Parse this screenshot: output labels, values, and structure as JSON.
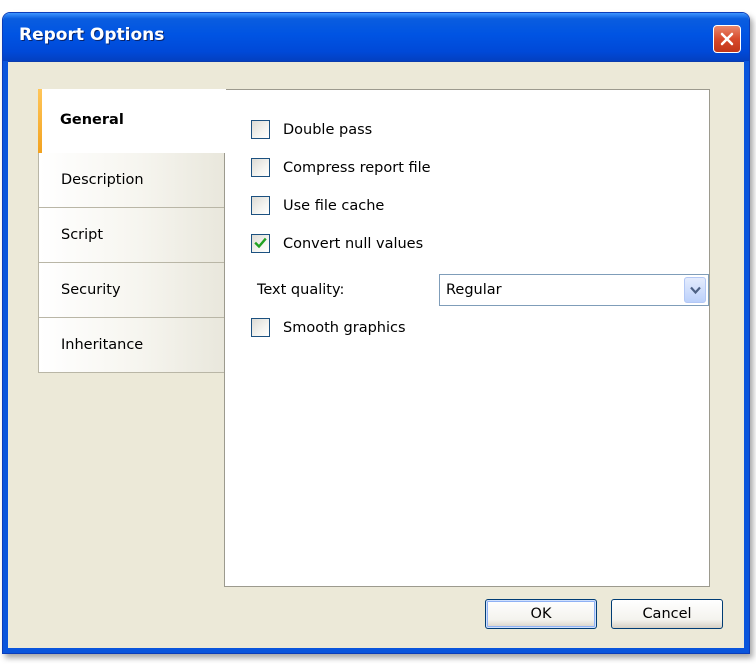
{
  "window": {
    "title": "Report Options"
  },
  "tabs": [
    {
      "label": "General",
      "active": true
    },
    {
      "label": "Description",
      "active": false
    },
    {
      "label": "Script",
      "active": false
    },
    {
      "label": "Security",
      "active": false
    },
    {
      "label": "Inheritance",
      "active": false
    }
  ],
  "general": {
    "double_pass": {
      "label": "Double pass",
      "checked": false
    },
    "compress": {
      "label": "Compress report file",
      "checked": false
    },
    "file_cache": {
      "label": "Use file cache",
      "checked": false
    },
    "convert_null": {
      "label": "Convert null values",
      "checked": true
    },
    "text_quality": {
      "label": "Text quality:",
      "value": "Regular"
    },
    "smooth_graphics": {
      "label": "Smooth graphics",
      "checked": false
    }
  },
  "buttons": {
    "ok": "OK",
    "cancel": "Cancel"
  },
  "colors": {
    "titlebar": "#0054e3",
    "tab_accent": "#f2a21f",
    "check_mark": "#21a121"
  }
}
